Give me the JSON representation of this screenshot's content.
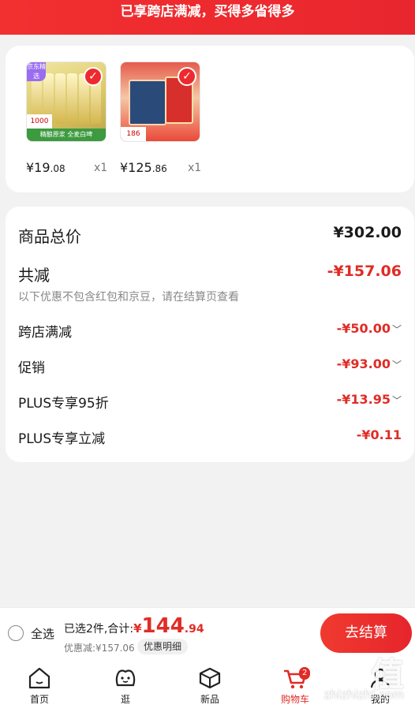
{
  "banner": {
    "text": "已享跨店满减，买得多省得多"
  },
  "products": [
    {
      "price_int": "¥19",
      "price_dec": ".08",
      "qty": "x1",
      "corner_badge": "京东精选",
      "tag_num": "1000",
      "strip": "精酿原浆 全麦白啤"
    },
    {
      "price_int": "¥125",
      "price_dec": ".86",
      "qty": "x1",
      "tag_num": "186",
      "strip": ""
    }
  ],
  "summary": {
    "total_label": "商品总价",
    "total_value": "¥302.00",
    "reduce_label": "共减",
    "reduce_value": "-¥157.06",
    "note": "以下优惠不包含红包和京豆，请在结算页查看",
    "items": [
      {
        "label": "跨店满减",
        "value": "-¥50.00"
      },
      {
        "label": "促销",
        "value": "-¥93.00"
      },
      {
        "label": "PLUS专享95折",
        "value": "-¥13.95"
      },
      {
        "label": "PLUS专享立减",
        "value": "-¥0.11"
      }
    ]
  },
  "bottom": {
    "select_all": "全选",
    "selected_text": "已选2件,合计:",
    "yen": "¥",
    "amount_int": "144",
    "amount_dec": ".94",
    "discount_text": "优惠减:¥157.06",
    "detail_button": "优惠明细",
    "checkout_button": "去结算"
  },
  "tabs": [
    {
      "label": "首页",
      "icon": "home-icon"
    },
    {
      "label": "逛",
      "icon": "face-icon"
    },
    {
      "label": "新品",
      "icon": "cube-icon"
    },
    {
      "label": "购物车",
      "icon": "cart-icon",
      "badge": "2",
      "active": true
    },
    {
      "label": "我的",
      "icon": "person-icon"
    }
  ],
  "watermark": {
    "logo": "值",
    "url": "zhizhizhi.com"
  },
  "colors": {
    "accent": "#e02c26",
    "banner": "#f23030"
  }
}
